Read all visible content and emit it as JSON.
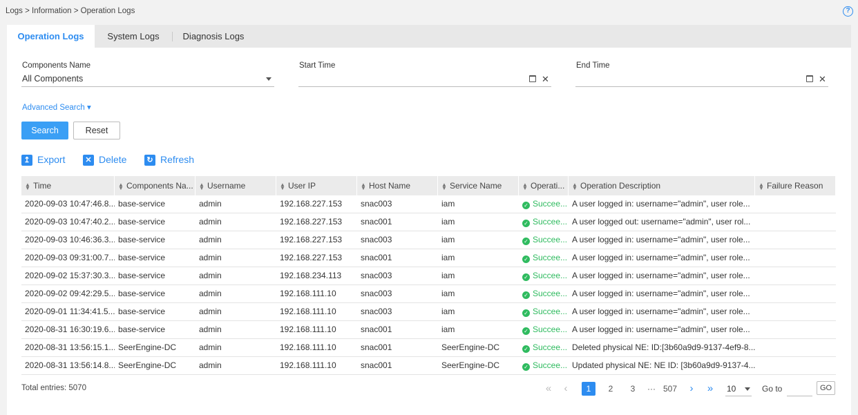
{
  "breadcrumb": "Logs > Information > Operation Logs",
  "help_icon": "?",
  "tabs": [
    {
      "label": "Operation Logs",
      "active": true
    },
    {
      "label": "System Logs",
      "active": false
    },
    {
      "label": "Diagnosis Logs",
      "active": false
    }
  ],
  "filters": {
    "components_label": "Components Name",
    "components_value": "All Components",
    "start_label": "Start Time",
    "start_value": "",
    "end_label": "End Time",
    "end_value": "",
    "clear_glyph": "✕"
  },
  "advanced_search": "Advanced Search ▾",
  "buttons": {
    "search": "Search",
    "reset": "Reset"
  },
  "actions": {
    "export": {
      "label": "Export",
      "icon": "export-icon",
      "glyph": "↥"
    },
    "delete": {
      "label": "Delete",
      "icon": "delete-icon",
      "glyph": "✕"
    },
    "refresh": {
      "label": "Refresh",
      "icon": "refresh-icon",
      "glyph": "↻"
    }
  },
  "columns": [
    "Time",
    "Components Na...",
    "Username",
    "User IP",
    "Host Name",
    "Service Name",
    "Operati...",
    "Operation Description",
    "Failure Reason"
  ],
  "rows": [
    {
      "time": "2020-09-03 10:47:46.8...",
      "component": "base-service",
      "username": "admin",
      "ip": "192.168.227.153",
      "host": "snac003",
      "service": "iam",
      "result": "Succee...",
      "desc": "A user logged in: username=\"admin\", user role...",
      "reason": ""
    },
    {
      "time": "2020-09-03 10:47:40.2...",
      "component": "base-service",
      "username": "admin",
      "ip": "192.168.227.153",
      "host": "snac001",
      "service": "iam",
      "result": "Succee...",
      "desc": "A user logged out: username=\"admin\", user rol...",
      "reason": ""
    },
    {
      "time": "2020-09-03 10:46:36.3...",
      "component": "base-service",
      "username": "admin",
      "ip": "192.168.227.153",
      "host": "snac003",
      "service": "iam",
      "result": "Succee...",
      "desc": "A user logged in: username=\"admin\", user role...",
      "reason": ""
    },
    {
      "time": "2020-09-03 09:31:00.7...",
      "component": "base-service",
      "username": "admin",
      "ip": "192.168.227.153",
      "host": "snac001",
      "service": "iam",
      "result": "Succee...",
      "desc": "A user logged in: username=\"admin\", user role...",
      "reason": ""
    },
    {
      "time": "2020-09-02 15:37:30.3...",
      "component": "base-service",
      "username": "admin",
      "ip": "192.168.234.113",
      "host": "snac003",
      "service": "iam",
      "result": "Succee...",
      "desc": "A user logged in: username=\"admin\", user role...",
      "reason": ""
    },
    {
      "time": "2020-09-02 09:42:29.5...",
      "component": "base-service",
      "username": "admin",
      "ip": "192.168.111.10",
      "host": "snac003",
      "service": "iam",
      "result": "Succee...",
      "desc": "A user logged in: username=\"admin\", user role...",
      "reason": ""
    },
    {
      "time": "2020-09-01 11:34:41.5...",
      "component": "base-service",
      "username": "admin",
      "ip": "192.168.111.10",
      "host": "snac003",
      "service": "iam",
      "result": "Succee...",
      "desc": "A user logged in: username=\"admin\", user role...",
      "reason": ""
    },
    {
      "time": "2020-08-31 16:30:19.6...",
      "component": "base-service",
      "username": "admin",
      "ip": "192.168.111.10",
      "host": "snac001",
      "service": "iam",
      "result": "Succee...",
      "desc": "A user logged in: username=\"admin\", user role...",
      "reason": ""
    },
    {
      "time": "2020-08-31 13:56:15.1...",
      "component": "SeerEngine-DC",
      "username": "admin",
      "ip": "192.168.111.10",
      "host": "snac001",
      "service": "SeerEngine-DC",
      "result": "Succee...",
      "desc": "Deleted physical NE: ID:[3b60a9d9-9137-4ef9-8...",
      "reason": ""
    },
    {
      "time": "2020-08-31 13:56:14.8...",
      "component": "SeerEngine-DC",
      "username": "admin",
      "ip": "192.168.111.10",
      "host": "snac001",
      "service": "SeerEngine-DC",
      "result": "Succee...",
      "desc": "Updated physical NE: NE ID: [3b60a9d9-9137-4...",
      "reason": ""
    }
  ],
  "footer": {
    "total": "Total entries: 5070",
    "pages": [
      "1",
      "2",
      "3",
      "···",
      "507"
    ],
    "current_page": "1",
    "nav": {
      "first": "«",
      "prev": "‹",
      "next": "›",
      "last": "»"
    },
    "page_size": "10",
    "goto_label": "Go to",
    "goto_value": "",
    "go_button": "GO"
  },
  "colors": {
    "accent": "#2d8cf0",
    "success": "#2fbb5f",
    "button": "#3a9ff5"
  }
}
